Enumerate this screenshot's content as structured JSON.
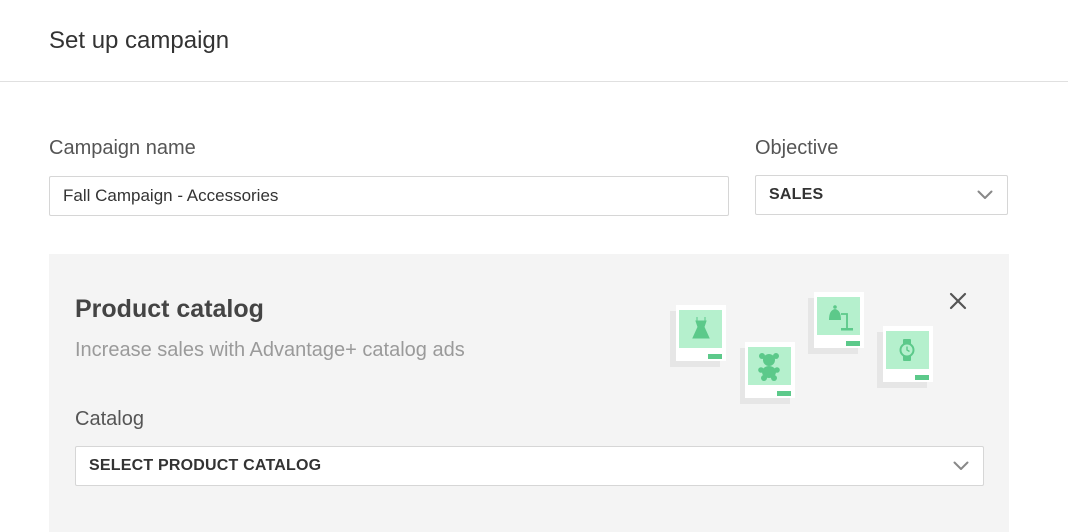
{
  "header": {
    "title": "Set up campaign"
  },
  "campaign_name": {
    "label": "Campaign name",
    "value": "Fall Campaign - Accessories"
  },
  "objective": {
    "label": "Objective",
    "selected": "SALES"
  },
  "catalog_panel": {
    "title": "Product catalog",
    "subtitle": "Increase sales with Advantage+ catalog ads",
    "catalog_label": "Catalog",
    "catalog_selected": "SELECT PRODUCT CATALOG"
  },
  "colors": {
    "accent_green": "#5cc98a",
    "tile_green": "#b5f0cd",
    "panel_bg": "#f4f4f4"
  },
  "icons": {
    "close": "close-icon",
    "chevron": "chevron-down-icon",
    "products": [
      "dress-icon",
      "teddy-bear-icon",
      "lamp-icon",
      "watch-icon"
    ]
  }
}
